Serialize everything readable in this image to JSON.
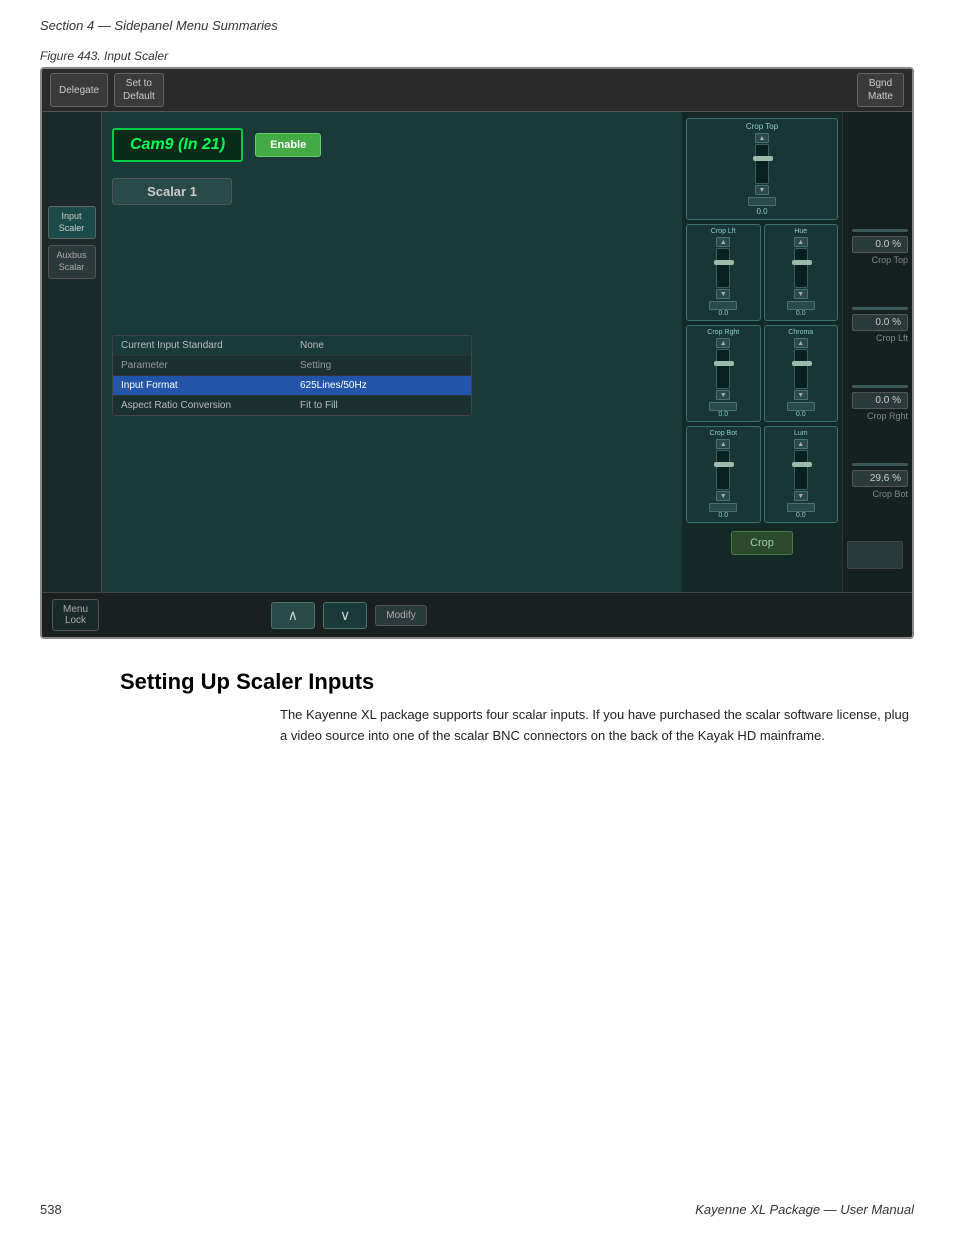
{
  "header": {
    "section": "Section 4 — Sidepanel Menu Summaries",
    "figure_caption": "Figure 443.  Input Scaler"
  },
  "top_bar": {
    "delegate_label": "Delegate",
    "set_default_label": "Set to\nDefault",
    "bgnd_matte_label": "Bgnd\nMatte"
  },
  "left_sidebar": {
    "input_scaler_label": "Input\nScaler",
    "auxbus_scaler_label": "Auxbus\nScalar"
  },
  "cam_info": {
    "cam_name": "Cam9  (In 21)",
    "enable_label": "Enable",
    "scalar_label": "Scalar 1"
  },
  "settings_table": {
    "col1_header": "Current Input Standard",
    "col1_value": "None",
    "col2_header": "Parameter",
    "col2_value": "Setting",
    "row_input_format": "Input Format",
    "row_input_format_value": "625Lines/50Hz",
    "row_aspect": "Aspect Ratio Conversion",
    "row_aspect_value": "Fit to Fill"
  },
  "crop_controls": {
    "crop_top_label": "Crop Top",
    "crop_top_value": "0.0",
    "crop_left_label": "Crop Lft",
    "crop_left_value": "0.0",
    "hue_label": "Hue",
    "hue_value": "0.0",
    "crop_right_label": "Crop Rght",
    "crop_right_value": "0.0",
    "chroma_label": "Chroma",
    "chroma_value": "0.0",
    "crop_bot_label": "Crop Bot",
    "crop_bot_value": "0.0",
    "lum_label": "Lum",
    "lum_value": "0.0",
    "crop_button_label": "Crop"
  },
  "right_readouts": {
    "crop_top_pct": "0.0 %",
    "crop_top_label": "Crop Top",
    "crop_left_pct": "0.0 %",
    "crop_left_label": "Crop Lft",
    "crop_right_pct": "0.0 %",
    "crop_right_label": "Crop Rght",
    "crop_bot_pct": "29.6 %",
    "crop_bot_label": "Crop Bot"
  },
  "bottom_bar": {
    "menu_lock_label": "Menu\nLock",
    "up_symbol": "∧",
    "down_symbol": "∨",
    "modify_label": "Modify"
  },
  "section": {
    "heading": "Setting Up Scaler Inputs",
    "body": "The Kayenne XL package supports four scalar inputs. If you have purchased the scalar software license, plug a video source into one of the scalar BNC connectors on the back of the Kayak HD mainframe."
  },
  "footer": {
    "page_number": "538",
    "manual_title": "Kayenne XL Package — User Manual"
  }
}
